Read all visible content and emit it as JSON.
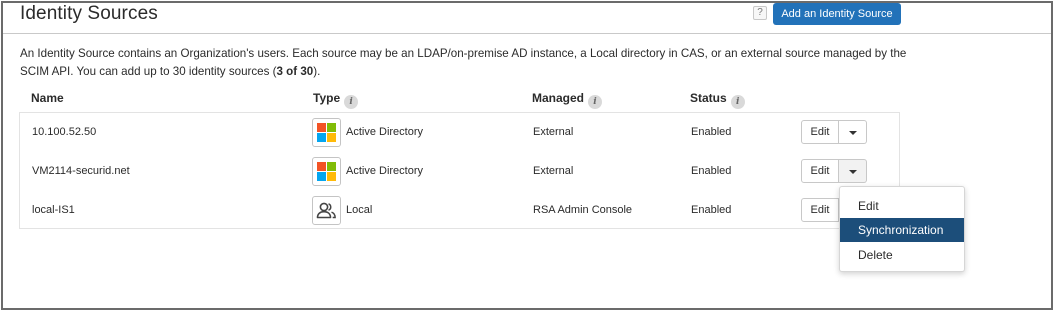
{
  "header": {
    "title": "Identity Sources",
    "help_label": "?",
    "add_button_label": "Add an Identity Source"
  },
  "description": {
    "text_before": "An Identity Source contains an Organization's users. Each source may be an LDAP/on-premise AD instance, a Local directory in CAS, or an external source managed by the SCIM API. You can add up to 30 identity sources (",
    "count_bold": "3 of 30",
    "text_after": ")."
  },
  "columns": {
    "name": "Name",
    "type": "Type",
    "managed": "Managed",
    "status": "Status",
    "info_glyph": "i"
  },
  "rows": [
    {
      "name": "10.100.52.50",
      "type_icon": "microsoft-windows-icon",
      "type": "Active Directory",
      "managed": "External",
      "status": "Enabled",
      "edit_label": "Edit"
    },
    {
      "name": "VM2114-securid.net",
      "type_icon": "microsoft-windows-icon",
      "type": "Active Directory",
      "managed": "External",
      "status": "Enabled",
      "edit_label": "Edit"
    },
    {
      "name": "local-IS1",
      "type_icon": "users-icon",
      "type": "Local",
      "managed": "RSA Admin Console",
      "status": "Enabled",
      "edit_label": "Edit"
    }
  ],
  "dropdown_menu": {
    "items": [
      {
        "label": "Edit",
        "highlighted": false
      },
      {
        "label": "Synchronization",
        "highlighted": true
      },
      {
        "label": "Delete",
        "highlighted": false
      }
    ]
  },
  "colors": {
    "primary_button": "#2272b9",
    "menu_highlight": "#1c4e7a"
  }
}
